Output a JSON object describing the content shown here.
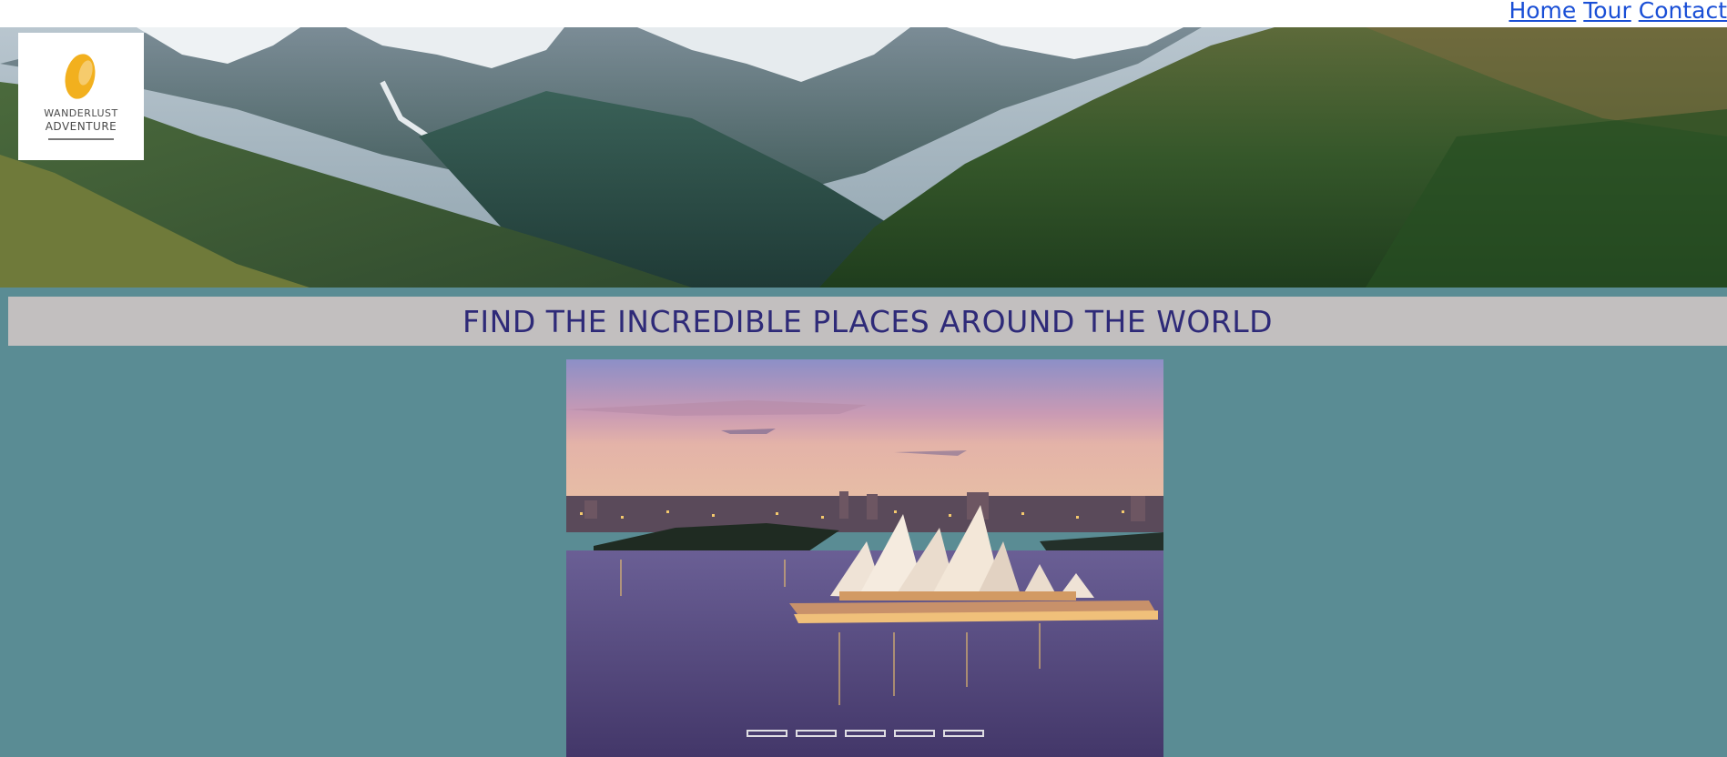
{
  "nav": {
    "links": [
      "Home",
      "Tour",
      "Contact"
    ]
  },
  "logo": {
    "line1": "WANDERLUST",
    "line2": "ADVENTURE",
    "brand_color": "#f2b01e"
  },
  "banner": {
    "heading": "FIND THE INCREDIBLE PLACES AROUND THE WORLD"
  },
  "carousel": {
    "slide_count": 5,
    "active_index": 0
  },
  "colors": {
    "page_bg": "#5a8c94",
    "banner_bg": "#c2bfbf",
    "heading": "#2e2a78",
    "link": "#1a4fd6"
  }
}
